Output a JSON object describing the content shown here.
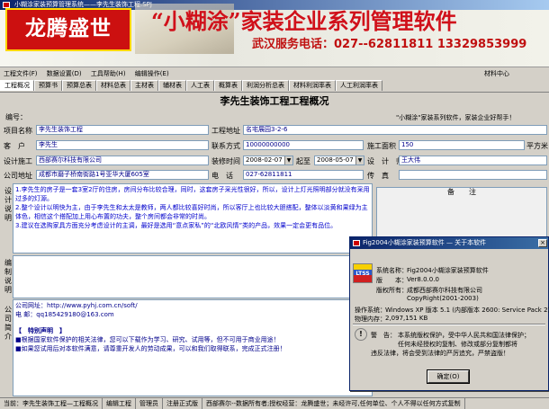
{
  "window": {
    "title": "小糊涂家装预算管理系统——李先生装饰工程.SPJ"
  },
  "banner": {
    "brand": "龙腾盛世",
    "slogan": "“小糊涂”家装企业系列管理软件",
    "phone": "武汉服务电话：027--62811811  13329853999"
  },
  "menu": {
    "items": [
      "工程文件(F)",
      "数据设置(D)",
      "工具帮助(H)",
      "编辑操作(E)"
    ],
    "material_center": "材料中心"
  },
  "tabs": [
    "工程概况",
    "预算书",
    "预算总表",
    "材料总表",
    "主材表",
    "辅材表",
    "人工表",
    "概算表",
    "利润分析总表",
    "材料利润率表",
    "人工利润率表"
  ],
  "form": {
    "page_title": "李先生装饰工程工程概况",
    "number_label": "编号：",
    "promo": "\"小糊涂\"家装系列软件，家装企业好帮手！",
    "project_name_label": "项目名称",
    "project_name": "李先生装饰工程",
    "site_label": "工程地址",
    "site": "名宅展园3-2-6",
    "client_label": "客　户",
    "client": "李先生",
    "contact_label": "联系方式",
    "contact": "10000000000",
    "area_label": "施工面积",
    "area": "150",
    "area_unit": "平方米",
    "builder_label": "设计施工",
    "builder": "西部赛尔科技有限公司",
    "decor_time_label": "装修时间",
    "start_date": "2008-02-07",
    "to_label": "起至",
    "end_date": "2008-05-07",
    "designer_label": "设　计　师",
    "designer": "王大伟",
    "company_addr_label": "公司地址",
    "company_addr": "成都市磨子桥南街路1号亚华大厦605室",
    "phone_label": "电　话",
    "phone": "027-62811811",
    "fax_label": "传　真",
    "fax": "",
    "design_label": "设计说明",
    "design_notes": [
      "1.李先生的房子是一套3室2厅的住房，房间分布比较合理，同时，这套房子采光性很好，所以，设计上灯光照明部分就没有采用过多的灯源。",
      "2.整个设计以明快为主，由于李先生和太太是教师，两人都比较喜好时尚，所以客厅上也比较大胆搭配，整体以淡黄和果绿为主体色，相信这个搭配加上用心布置的功夫，整个房间都会非常的时尚。",
      "3.建议在选购家具方面充分考虑设计的主调，最好是选用“意点家私”的“北欧风情”类的产品，效果一定会更有品位。"
    ],
    "remarks_label": "备　　注",
    "prep_label": "编制说明",
    "company_label": "公司简介",
    "company_lines": [
      "公司网址：http://www.pyhj.com.cn/soft/",
      "电    邮：qq185429180@163.com"
    ],
    "company_notice_title": "【　特别声明　】",
    "company_notice": [
      "■根据国家软件保护的相关法律，您可以下载作为学习、研究、试用等，但不可用于商业用途！",
      "■如果您试用后对本软件满意，请尊重开发人的劳动成果，可以和我们取得联系，完成正式注册！"
    ]
  },
  "statusbar": [
    "当前：李先生装饰工程—工程概况",
    "编辑工程",
    "管理员",
    "注册正式版",
    "西部赛尔--数据所有者;授权经营：龙腾盛世；未经许可,任何单位、个人不得以任何方式复制"
  ],
  "about": {
    "title": "Fig2004小糊涂家装预算软件 — 关于本软件",
    "logo_text": "LTSS",
    "name_label": "系统名称：",
    "name": "Fig2004小糊涂家装预算软件",
    "version_label": "版　　本：",
    "version": "Ver8.0.0.0",
    "rights_label": "版权所有：",
    "rights": "成都西部赛尔科技有限公司",
    "copyright": "CopyRight(2001-2003)",
    "os_label": "操作系统：",
    "os": "Windows XP 版本 5.1 (内部版本 2600: Service Pack 2)",
    "mem_label": "物理内存：",
    "mem": "2,097,151 KB",
    "warn_label": "警　告：",
    "warn_lines": [
      "本系统版权保护，受中华人民共和国法律保护；",
      "任何未经授权的复制、修改或部分复制都将",
      "违反法律，将会受到法律的严厉追究，严禁盗版！"
    ],
    "ok_label": "确定(O)"
  }
}
